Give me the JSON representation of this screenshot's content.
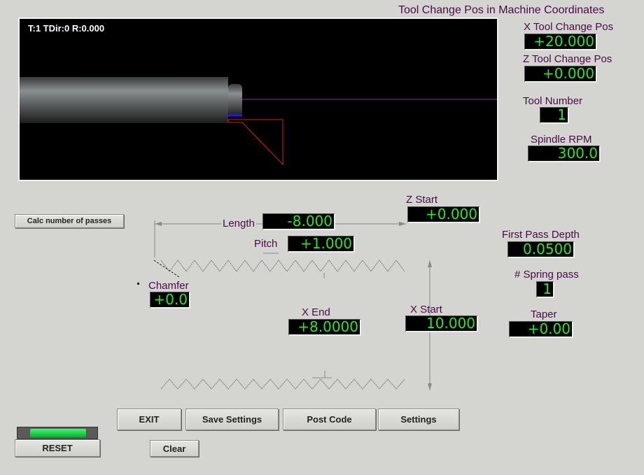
{
  "header": {
    "title": "Tool Change Pos in Machine Coordinates"
  },
  "viewport": {
    "status": "T:1 TDir:0 R:0.000"
  },
  "tool_change": {
    "x_label": "X Tool Change Pos",
    "x_value": "+20.000",
    "z_label": "Z Tool Change Pos",
    "z_value": "+0.000"
  },
  "tool": {
    "label": "Tool Number",
    "value": "1"
  },
  "spindle": {
    "label": "Spindle RPM",
    "value": "300.0"
  },
  "calc_button": "Calc number of passes",
  "thread": {
    "length_label": "Length",
    "length_value": "-8.000",
    "pitch_label": "Pitch",
    "pitch_value": "+1.000",
    "chamfer_label": "Chamfer",
    "chamfer_value": "+0.0",
    "z_start_label": "Z Start",
    "z_start_value": "+0.000",
    "x_end_label": "X End",
    "x_end_value": "+8.0000",
    "x_start_label": "X Start",
    "x_start_value": "10.000"
  },
  "passes": {
    "first_depth_label": "First Pass Depth",
    "first_depth_value": "0.0500",
    "spring_label": "# Spring pass",
    "spring_value": "1",
    "taper_label": "Taper",
    "taper_value": "+0.00"
  },
  "buttons": {
    "exit": "EXIT",
    "save": "Save Settings",
    "post": "Post Code",
    "settings": "Settings",
    "reset": "RESET",
    "clear": "Clear"
  },
  "colors": {
    "dro_text": "#28e628",
    "label_text": "#4a0a4a",
    "background": "#d4d4d0"
  }
}
